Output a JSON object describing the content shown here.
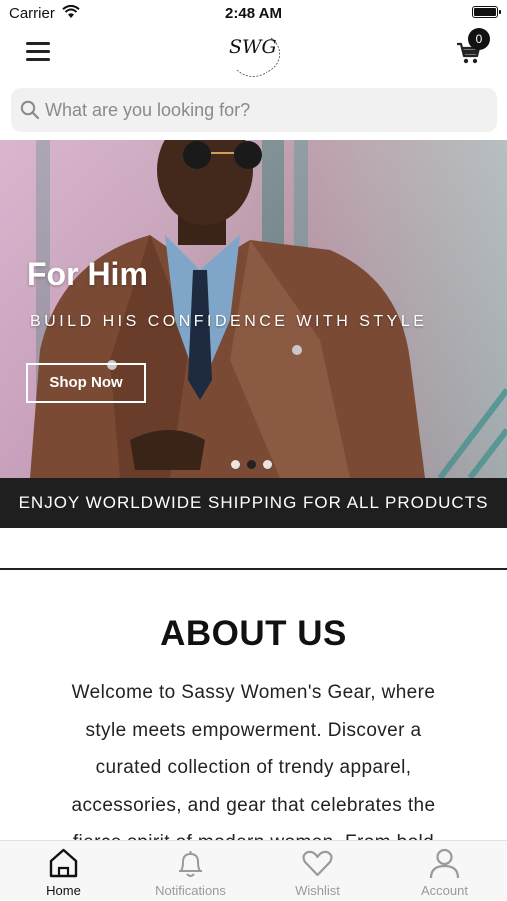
{
  "status_bar": {
    "carrier": "Carrier",
    "time": "2:48 AM"
  },
  "header": {
    "logo_text": "SWG",
    "logo_ring_text": "SASSY WOMEN'S",
    "cart_count": "0"
  },
  "search": {
    "placeholder": "What are you looking for?"
  },
  "hero": {
    "title": "For Him",
    "subtitle": "BUILD HIS CONFIDENCE WITH STYLE",
    "button_label": "Shop Now",
    "active_slide": 2,
    "slide_count": 3
  },
  "shipping_banner": "ENJOY WORLDWIDE SHIPPING FOR ALL PRODUCTS",
  "about": {
    "title": "ABOUT US",
    "text": "Welcome to Sassy Women's Gear, where style meets empowerment. Discover a curated collection of trendy apparel, accessories, and gear that celebrates the fierce spirit of modern women. From bold"
  },
  "tabs": [
    {
      "label": "Home",
      "icon": "home-icon",
      "active": true
    },
    {
      "label": "Notifications",
      "icon": "bell-icon",
      "active": false
    },
    {
      "label": "Wishlist",
      "icon": "heart-icon",
      "active": false
    },
    {
      "label": "Account",
      "icon": "user-icon",
      "active": false
    }
  ],
  "colors": {
    "dark": "#1f1f1f",
    "inactive_tab": "#9a9a9a",
    "search_bg": "#f1f1f1"
  }
}
